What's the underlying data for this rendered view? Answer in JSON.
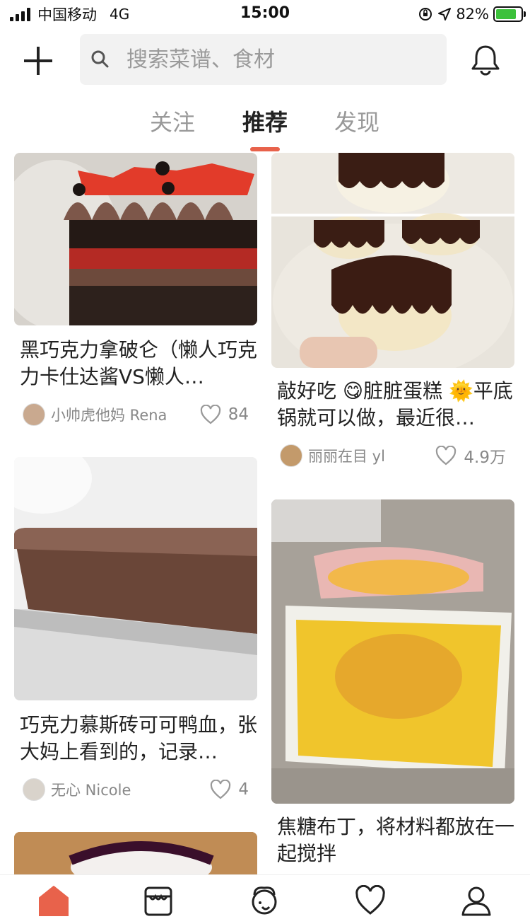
{
  "status_bar": {
    "carrier": "中国移动",
    "network": "4G",
    "time": "15:00",
    "battery": "82%",
    "battery_level": 0.82
  },
  "header": {
    "add_icon": "plus-icon",
    "search_placeholder": "搜索菜谱、食材",
    "search_icon": "search-icon",
    "notification_icon": "bell-icon"
  },
  "tabs": [
    {
      "label": "关注",
      "active": false
    },
    {
      "label": "推荐",
      "active": true
    },
    {
      "label": "发现",
      "active": false
    }
  ],
  "accent_color": "#e8624b",
  "feed": {
    "cards": [
      {
        "title": "黑巧克力拿破仑（懒人巧克力卡仕达酱VS懒人…",
        "author": "小帅虎他妈 Rena",
        "likes": "84",
        "image": "chocolate-napoleon-cake"
      },
      {
        "title": "敲好吃 😋脏脏蛋糕 🌞平底锅就可以做，最近很…",
        "author": "丽丽在目 yl",
        "likes": "4.9万",
        "image": "dirty-cake"
      },
      {
        "title": "巧克力慕斯砖可可鸭血，张大妈上看到的，记录…",
        "author": "无心 Nicole",
        "likes": "4",
        "image": "chocolate-mousse-brick"
      },
      {
        "title": "焦糖布丁，将材料都放在一起搅拌",
        "author": "",
        "likes": "",
        "image": "caramel-pudding"
      },
      {
        "title": "",
        "author": "",
        "likes": "",
        "image": "berry-tart"
      }
    ]
  },
  "bottom_nav": [
    {
      "icon": "home-icon",
      "active": true
    },
    {
      "icon": "store-icon",
      "active": false
    },
    {
      "icon": "chef-icon",
      "active": false
    },
    {
      "icon": "heart-icon",
      "active": false
    },
    {
      "icon": "profile-icon",
      "active": false
    }
  ]
}
